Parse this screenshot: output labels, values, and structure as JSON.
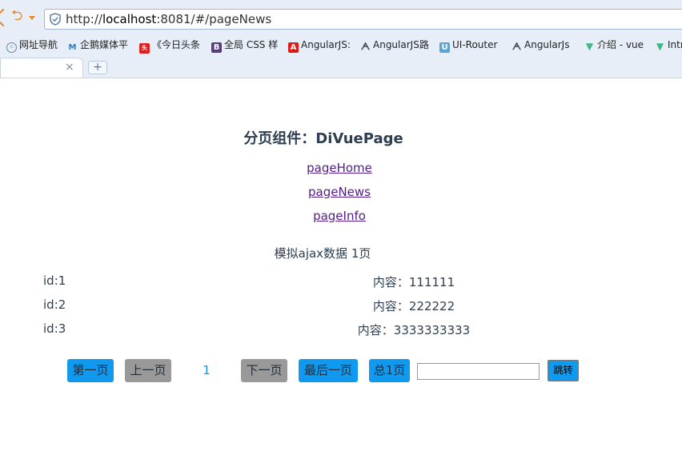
{
  "browser": {
    "url_prefix": "http://",
    "url_host": "localhost",
    "url_rest": ":8081/#/pageNews",
    "bookmarks": [
      {
        "label": "网址导航",
        "icon": "globe-icon"
      },
      {
        "label": "企鹅媒体平",
        "icon": "penguin-media-icon"
      },
      {
        "label": "《今日头条",
        "icon": "toutiao-icon"
      },
      {
        "label": "全局 CSS 样",
        "icon": "bootstrap-icon"
      },
      {
        "label": "AngularJS:",
        "icon": "angular-icon"
      },
      {
        "label": "AngularJS路",
        "icon": "angularjs-ui-icon"
      },
      {
        "label": "UI-Router",
        "icon": "ui-router-icon"
      },
      {
        "label": "AngularJs",
        "icon": "angularjs-ui-icon"
      },
      {
        "label": "介绍 - vue",
        "icon": "vue-icon"
      },
      {
        "label": "Intr",
        "icon": "vue-icon"
      }
    ],
    "tab_close": "×",
    "new_tab": "+"
  },
  "page": {
    "title": "分页组件：DiVuePage",
    "nav": [
      "pageHome",
      "pageNews",
      "pageInfo"
    ],
    "subtitle": "模拟ajax数据 1页",
    "rows": [
      {
        "id": "id:1",
        "content": "内容：111111"
      },
      {
        "id": "id:2",
        "content": "内容：222222"
      },
      {
        "id": "id:3",
        "content": "内容：3333333333"
      }
    ]
  },
  "pager": {
    "first": "第一页",
    "prev": "上一页",
    "current": "1",
    "next": "下一页",
    "last": "最后一页",
    "total": "总1页",
    "input_value": "",
    "jump": "跳转"
  },
  "colors": {
    "primary": "#0f9af0",
    "disabled": "#999999",
    "text": "#2c3e50",
    "visited_link": "#551a8b"
  }
}
